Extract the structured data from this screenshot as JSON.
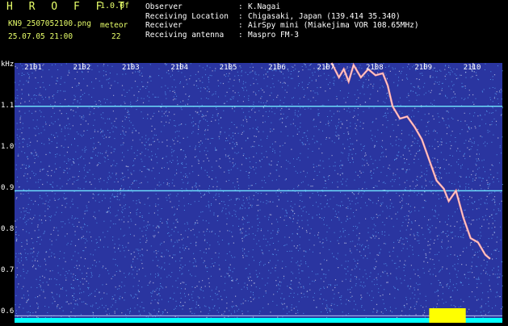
{
  "header": {
    "brand": "H R O F F T",
    "version": "1.0.0f",
    "filename": "KN9_2507052100.png",
    "meteor_label": "meteor",
    "datetime": "25.07.05 21:00",
    "meteor_count": "22",
    "fields": [
      {
        "label": "Observer",
        "value": "K.Nagai"
      },
      {
        "label": "Receiving Location",
        "value": "Chigasaki, Japan (139.414 35.340)"
      },
      {
        "label": "Receiver",
        "value": "AirSpy mini (Miakejima VOR 108.65MHz)"
      },
      {
        "label": "Receiving antenna",
        "value": "Maspro FM-3"
      }
    ]
  },
  "chart_data": {
    "type": "heatmap",
    "ylabel": "kHz",
    "y_ticks": [
      "1.1",
      "1.0",
      "0.9",
      "0.8",
      "0.7",
      "0.6"
    ],
    "x_ticks": [
      "2101",
      "2102",
      "2103",
      "2104",
      "2105",
      "2106",
      "2107",
      "2108",
      "2109",
      "2110"
    ],
    "ylim": [
      0.575,
      1.205
    ],
    "xlim": [
      2100.6,
      2110.6
    ],
    "colors": {
      "background": "#2a35a0",
      "noise": "#5fb0ff",
      "carrier": "#70e6ff",
      "trace": "#ff9a9a",
      "level": "#ffff00",
      "baseline": "#00ffff"
    },
    "carrier_lines_khz": [
      1.1,
      0.895
    ],
    "trace": [
      [
        2107.1,
        1.205
      ],
      [
        2107.25,
        1.17
      ],
      [
        2107.35,
        1.19
      ],
      [
        2107.45,
        1.16
      ],
      [
        2107.55,
        1.2
      ],
      [
        2107.7,
        1.17
      ],
      [
        2107.85,
        1.19
      ],
      [
        2108.0,
        1.175
      ],
      [
        2108.15,
        1.18
      ],
      [
        2108.25,
        1.15
      ],
      [
        2108.35,
        1.1
      ],
      [
        2108.5,
        1.07
      ],
      [
        2108.65,
        1.075
      ],
      [
        2108.8,
        1.05
      ],
      [
        2108.95,
        1.02
      ],
      [
        2109.1,
        0.97
      ],
      [
        2109.25,
        0.92
      ],
      [
        2109.4,
        0.9
      ],
      [
        2109.5,
        0.87
      ],
      [
        2109.65,
        0.895
      ],
      [
        2109.8,
        0.83
      ],
      [
        2109.95,
        0.78
      ],
      [
        2110.1,
        0.77
      ],
      [
        2110.25,
        0.74
      ],
      [
        2110.35,
        0.73
      ]
    ],
    "baseline_levels": [
      0.577,
      0.592
    ],
    "yellow_block": {
      "x0": 2109.1,
      "x1": 2109.85
    }
  }
}
